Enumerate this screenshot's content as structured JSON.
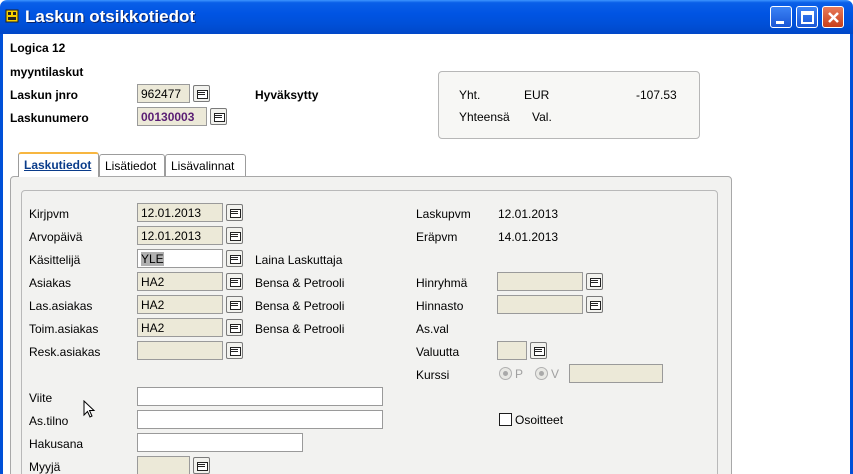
{
  "window": {
    "title": "Laskun otsikkotiedot"
  },
  "header": {
    "company": "Logica 12",
    "ledger": "myyntilaskut",
    "invoice_jnro_label": "Laskun jnro",
    "invoice_jnro_value": "962477",
    "status": "Hyväksytty",
    "invoice_number_label": "Laskunumero",
    "invoice_number_value": "00130003"
  },
  "summary": {
    "total_label": "Yht.",
    "currency": "EUR",
    "total_value": "-107.53",
    "total_sum_label": "Yhteensä",
    "val_label": "Val."
  },
  "tabs": [
    {
      "label": "Laskutiedot",
      "active": true
    },
    {
      "label": "Lisätiedot",
      "active": false
    },
    {
      "label": "Lisävalinnat",
      "active": false
    }
  ],
  "form": {
    "kirjpvm_label": "Kirjpvm",
    "kirjpvm_value": "12.01.2013",
    "arvopaiva_label": "Arvopäivä",
    "arvopaiva_value": "12.01.2013",
    "kasittelija_label": "Käsittelijä",
    "kasittelija_value": "YLE",
    "kasittelija_name": "Laina Laskuttaja",
    "asiakas_label": "Asiakas",
    "asiakas_value": "HA2",
    "asiakas_name": "Bensa & Petrooli",
    "las_asiakas_label": "Las.asiakas",
    "las_asiakas_value": "HA2",
    "las_asiakas_name": "Bensa & Petrooli",
    "toim_asiakas_label": "Toim.asiakas",
    "toim_asiakas_value": "HA2",
    "toim_asiakas_name": "Bensa & Petrooli",
    "resk_asiakas_label": "Resk.asiakas",
    "viite_label": "Viite",
    "as_tilno_label": "As.tilno",
    "hakusana_label": "Hakusana",
    "myyja_label": "Myyjä",
    "laskupvm_label": "Laskupvm",
    "laskupvm_value": "12.01.2013",
    "erapvm_label": "Eräpvm",
    "erapvm_value": "14.01.2013",
    "hinryhma_label": "Hinryhmä",
    "hinnasto_label": "Hinnasto",
    "as_val_label": "As.val",
    "valuutta_label": "Valuutta",
    "kurssi_label": "Kurssi",
    "kurssi_p": "P",
    "kurssi_v": "V",
    "osoitteet_label": "Osoitteet"
  }
}
